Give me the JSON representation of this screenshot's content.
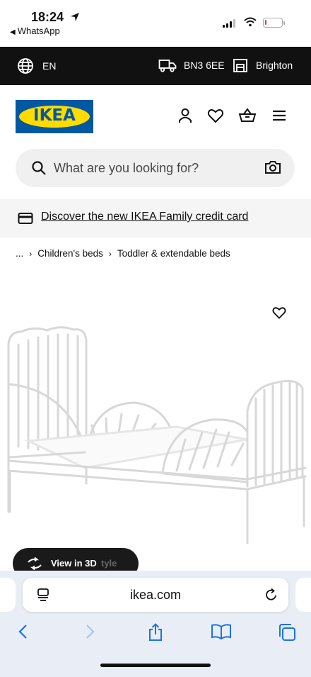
{
  "status_bar": {
    "time": "18:24",
    "back_app": "WhatsApp",
    "battery_level": 0.1
  },
  "top_bar": {
    "language": "EN",
    "postcode": "BN3 6EE",
    "store": "Brighton"
  },
  "header": {
    "logo_text": "IKEA",
    "icons": [
      "user-icon",
      "heart-icon",
      "basket-icon",
      "menu-icon"
    ],
    "brand_blue": "#0058a3",
    "brand_yellow": "#ffdb00"
  },
  "search": {
    "placeholder": "What are you looking for?"
  },
  "banner": {
    "text": "Discover the new IKEA Family credit card"
  },
  "breadcrumb": {
    "ellipsis": "...",
    "items": [
      "Children's beds",
      "Toddler & extendable beds"
    ]
  },
  "product": {
    "view_3d_label": "View in 3D",
    "overlap_text": "tyle"
  },
  "browser": {
    "url": "ikea.com"
  }
}
